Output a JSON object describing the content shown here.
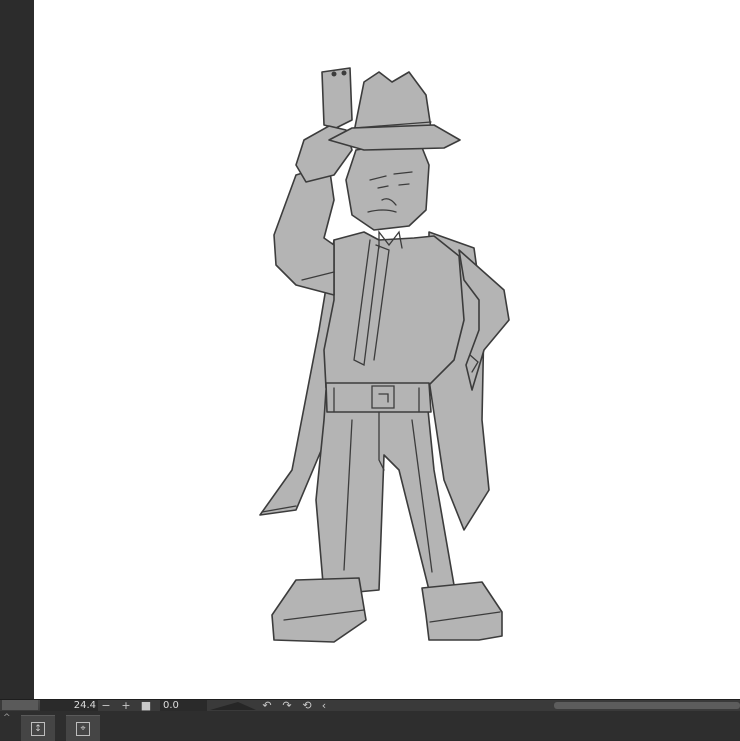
{
  "canvas": {
    "background": "#ffffff",
    "artwork": "detective-sketch"
  },
  "status_bar": {
    "zoom_value": "24.4",
    "zoom_out_icon": "minus-icon",
    "zoom_in_icon": "plus-icon",
    "fit_icon": "square-icon",
    "angle_value": "0.0",
    "rotate_left_icon": "rotate-ccw-icon",
    "rotate_right_icon": "rotate-cw-icon",
    "reset_rotation_icon": "reset-rotation-icon",
    "collapse_icon": "chevron-left-icon"
  },
  "bottom_panel": {
    "collapse_icon": "chevron-up-icon",
    "buttons": [
      {
        "icon": "layer-order-icon"
      },
      {
        "icon": "navigator-icon"
      }
    ]
  },
  "colors": {
    "ui_dark": "#2b2b2b",
    "status_bar": "#3a3a3a",
    "sketch_fill": "#b3b3b3",
    "sketch_line": "#3c3c3c"
  }
}
